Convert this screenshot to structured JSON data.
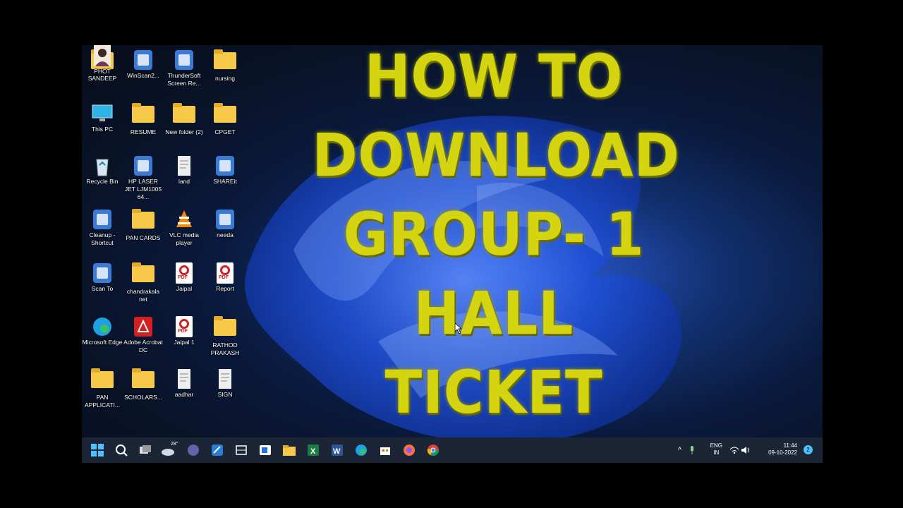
{
  "overlay_title": [
    "HOW TO",
    "DOWNLOAD",
    "GROUP- 1",
    "HALL TICKET"
  ],
  "desktop_icons": [
    {
      "label": "SANDEEP",
      "kind": "folder"
    },
    {
      "label": "WinScan2...",
      "kind": "app"
    },
    {
      "label": "ThunderSoft Screen Re...",
      "kind": "app"
    },
    {
      "label": "nursing",
      "kind": "folder"
    },
    {
      "label": "This PC",
      "kind": "monitor"
    },
    {
      "label": "RESUME",
      "kind": "folder"
    },
    {
      "label": "New folder (2)",
      "kind": "folder"
    },
    {
      "label": "CPGET",
      "kind": "folder"
    },
    {
      "label": "Recycle Bin",
      "kind": "bin"
    },
    {
      "label": "HP LASER JET LJM1005 64...",
      "kind": "app"
    },
    {
      "label": "land",
      "kind": "doc"
    },
    {
      "label": "SHAREit",
      "kind": "app"
    },
    {
      "label": "Cleanup - Shortcut",
      "kind": "app"
    },
    {
      "label": "PAN CARDS",
      "kind": "folder"
    },
    {
      "label": "VLC media player",
      "kind": "vlc"
    },
    {
      "label": "needa",
      "kind": "app"
    },
    {
      "label": "Scan To",
      "kind": "app"
    },
    {
      "label": "chandrakala net",
      "kind": "folder"
    },
    {
      "label": "Jaipal",
      "kind": "pdf"
    },
    {
      "label": "Report",
      "kind": "pdf"
    },
    {
      "label": "Microsoft Edge",
      "kind": "edge"
    },
    {
      "label": "Adobe Acrobat DC",
      "kind": "acrobat"
    },
    {
      "label": "Jaipal 1",
      "kind": "pdf"
    },
    {
      "label": "RATHOD PRAKASH",
      "kind": "folder"
    },
    {
      "label": "PAN APPLICATI...",
      "kind": "folder"
    },
    {
      "label": "SCHOLARS...",
      "kind": "folder"
    },
    {
      "label": "aadhar",
      "kind": "doc"
    },
    {
      "label": "SIGN",
      "kind": "doc"
    },
    {
      "label": "PHOT",
      "kind": "photo"
    }
  ],
  "taskbar": {
    "weather_temp": "28°",
    "apps": [
      "start-icon",
      "search-icon",
      "task-view-icon",
      "weather-icon",
      "teams-icon",
      "paint-icon",
      "scanner-icon",
      "photos-icon",
      "file-explorer-icon",
      "excel-icon",
      "word-icon",
      "edge-icon",
      "store-icon",
      "firefox-icon",
      "chrome-icon"
    ],
    "lang": "ENG",
    "region": "IN",
    "time": "11:44",
    "date": "09-10-2022",
    "notification_count": "2"
  }
}
